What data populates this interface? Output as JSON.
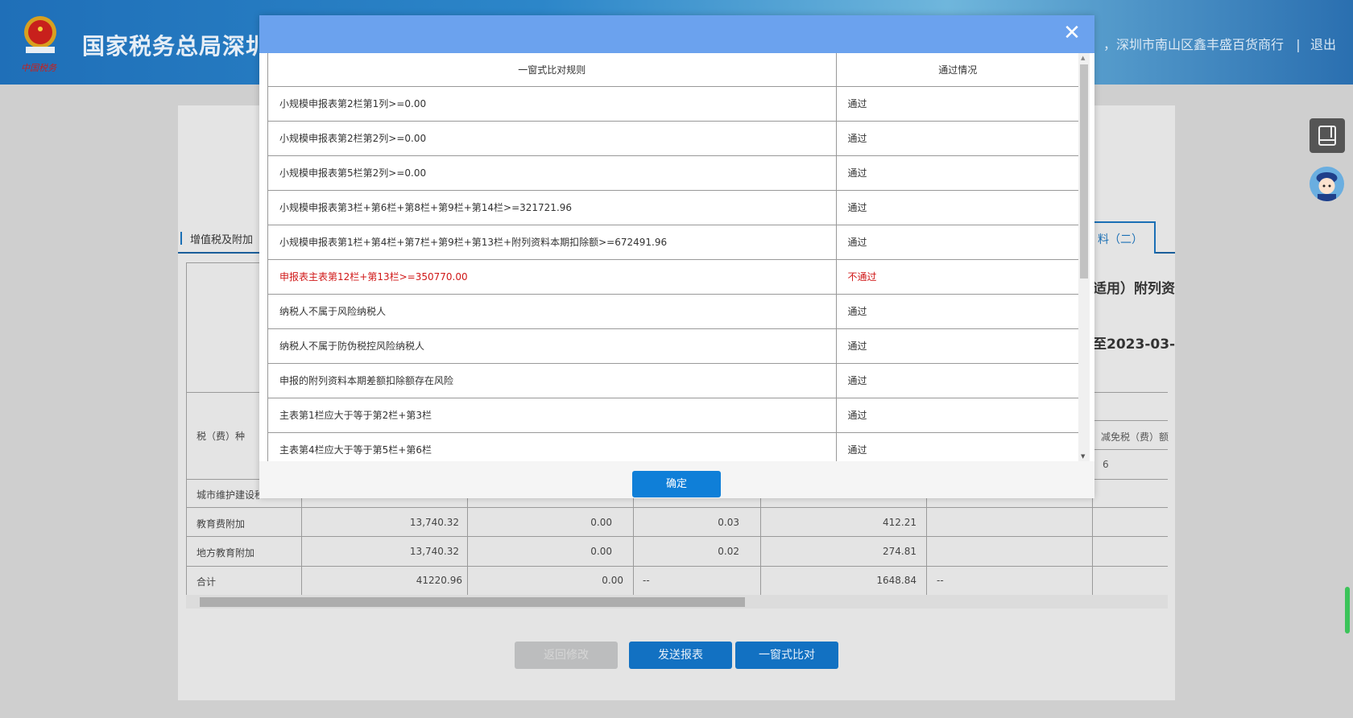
{
  "header": {
    "site_title": "国家税务总局深圳",
    "user_info": "，深圳市南山区鑫丰盛百货商行",
    "separator": "|",
    "logout": "退出",
    "logo_text": "中国税务"
  },
  "background_page": {
    "tab_left": "增值税及附加",
    "tab_right": "料（二）",
    "form_title_fragment": "适用）附列资",
    "period_fragment": "至2023-03-",
    "col_header_fragment": "减免税（费）额",
    "col_number_fragment": "6",
    "row_header": "税（费）种",
    "rows": [
      {
        "name": "城市维护建设税",
        "c1": "",
        "c2": "",
        "c3": "",
        "c4": ""
      },
      {
        "name": "教育费附加",
        "c1": "13,740.32",
        "c2": "0.00",
        "c3": "0.03",
        "c4": "412.21"
      },
      {
        "name": "地方教育附加",
        "c1": "13,740.32",
        "c2": "0.00",
        "c3": "0.02",
        "c4": "274.81"
      },
      {
        "name": "合计",
        "c1": "41220.96",
        "c2": "0.00",
        "c3": "--",
        "c4": "1648.84",
        "c5": "--"
      }
    ],
    "buttons": {
      "back": "返回修改",
      "send": "发送报表",
      "compare": "一窗式比对"
    }
  },
  "modal": {
    "close_icon": "close-icon",
    "columns": [
      "一窗式比对规则",
      "通过情况"
    ],
    "rows": [
      {
        "rule": "小规模申报表第2栏第1列>=0.00",
        "status": "通过"
      },
      {
        "rule": "小规模申报表第2栏第2列>=0.00",
        "status": "通过"
      },
      {
        "rule": "小规模申报表第5栏第2列>=0.00",
        "status": "通过"
      },
      {
        "rule": "小规模申报表第3栏+第6栏+第8栏+第9栏+第14栏>=321721.96",
        "status": "通过"
      },
      {
        "rule": "小规模申报表第1栏+第4栏+第7栏+第9栏+第13栏+附列资料本期扣除额>=672491.96",
        "status": "通过"
      },
      {
        "rule": "申报表主表第12栏+第13栏>=350770.00",
        "status": "不通过",
        "fail": true
      },
      {
        "rule": "纳税人不属于风险纳税人",
        "status": "通过"
      },
      {
        "rule": "纳税人不属于防伪税控风险纳税人",
        "status": "通过"
      },
      {
        "rule": "申报的附列资料本期差额扣除额存在风险",
        "status": "通过"
      },
      {
        "rule": "主表第1栏应大于等于第2栏+第3栏",
        "status": "通过"
      },
      {
        "rule": "主表第4栏应大于等于第5栏+第6栏",
        "status": "通过"
      }
    ],
    "confirm": "确定"
  },
  "colors": {
    "modal_header": "#6ba2ee",
    "primary_button": "#1271c2",
    "fail_text": "#d01818"
  }
}
